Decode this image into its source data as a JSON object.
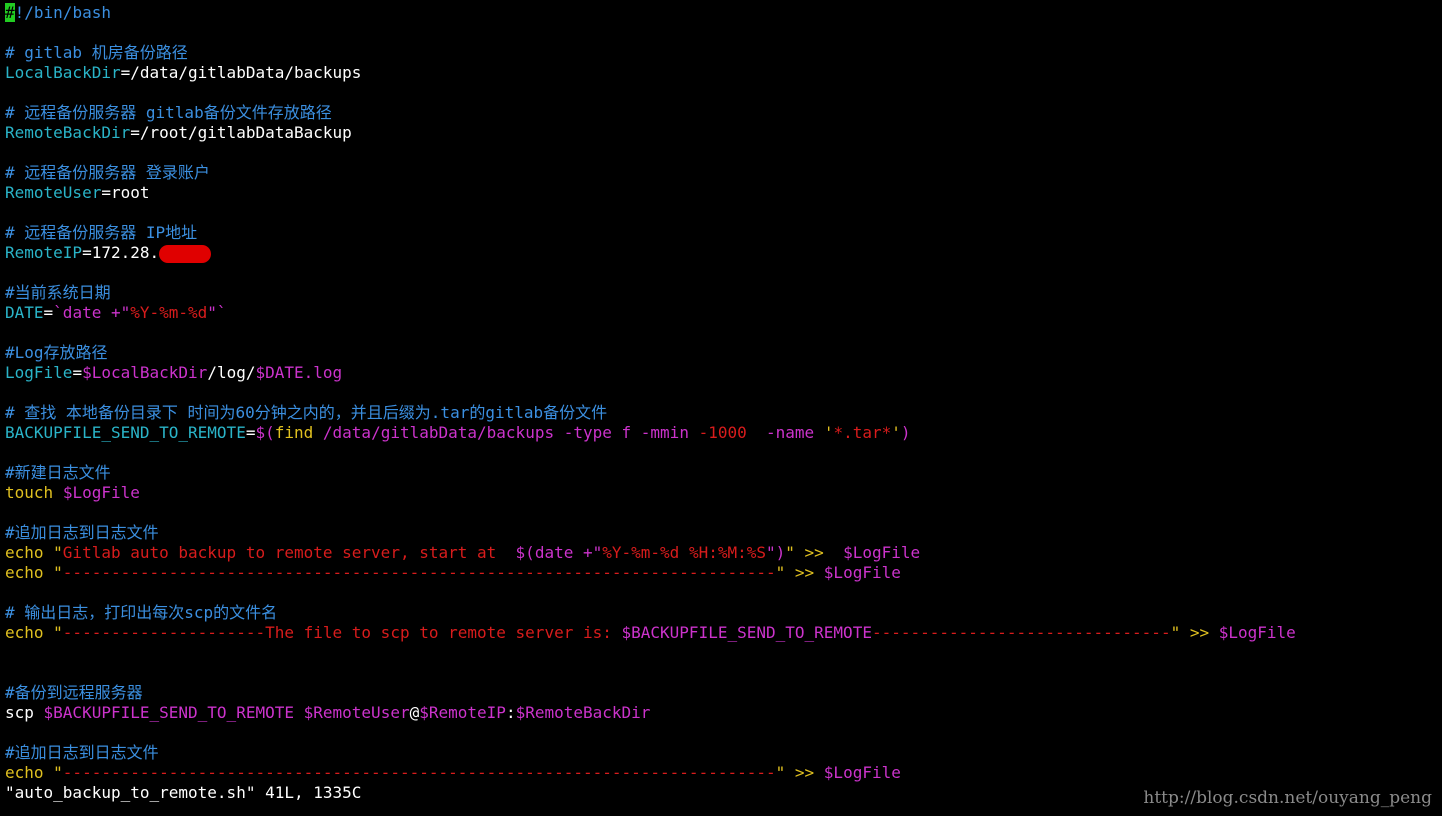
{
  "editor": {
    "status_line": "\"auto_backup_to_remote.sh\" 41L, 1335C",
    "watermark": "http://blog.csdn.net/ouyang_peng"
  },
  "colors": {
    "comment": "#3b8fe0",
    "variable": "#2ab4c8",
    "plain": "#ffffff",
    "string": "#d81c1c",
    "expansion": "#cc33cc",
    "keyword": "#e0c020",
    "cursor": "#22cc22",
    "redaction": "#e00000"
  },
  "lines": [
    {
      "segments": [
        {
          "text": "#",
          "cls": "cursor"
        },
        {
          "text": "!/bin/bash",
          "color": "#3b8fe0"
        }
      ]
    },
    {
      "segments": []
    },
    {
      "segments": [
        {
          "text": "# gitlab 机房备份路径",
          "color": "#3b8fe0"
        }
      ]
    },
    {
      "segments": [
        {
          "text": "LocalBackDir",
          "color": "#2ab4c8"
        },
        {
          "text": "=/data/gitlabData/backups",
          "color": "#ffffff"
        }
      ]
    },
    {
      "segments": []
    },
    {
      "segments": [
        {
          "text": "# 远程备份服务器 gitlab备份文件存放路径",
          "color": "#3b8fe0"
        }
      ]
    },
    {
      "segments": [
        {
          "text": "RemoteBackDir",
          "color": "#2ab4c8"
        },
        {
          "text": "=/root/gitlabDataBackup",
          "color": "#ffffff"
        }
      ]
    },
    {
      "segments": []
    },
    {
      "segments": [
        {
          "text": "# 远程备份服务器 登录账户",
          "color": "#3b8fe0"
        }
      ]
    },
    {
      "segments": [
        {
          "text": "RemoteUser",
          "color": "#2ab4c8"
        },
        {
          "text": "=root",
          "color": "#ffffff"
        }
      ]
    },
    {
      "segments": []
    },
    {
      "segments": [
        {
          "text": "# 远程备份服务器 IP地址",
          "color": "#3b8fe0"
        }
      ]
    },
    {
      "segments": [
        {
          "text": "RemoteIP",
          "color": "#2ab4c8"
        },
        {
          "text": "=172.28.",
          "color": "#ffffff"
        },
        {
          "redacted": true
        }
      ]
    },
    {
      "segments": []
    },
    {
      "segments": [
        {
          "text": "#当前系统日期",
          "color": "#3b8fe0"
        }
      ]
    },
    {
      "segments": [
        {
          "text": "DATE",
          "color": "#2ab4c8"
        },
        {
          "text": "=",
          "color": "#ffffff"
        },
        {
          "text": "`date +\"",
          "color": "#cc33cc"
        },
        {
          "text": "%Y-%m-%d",
          "color": "#d81c1c"
        },
        {
          "text": "\"`",
          "color": "#cc33cc"
        }
      ]
    },
    {
      "segments": []
    },
    {
      "segments": [
        {
          "text": "#Log存放路径",
          "color": "#3b8fe0"
        }
      ]
    },
    {
      "segments": [
        {
          "text": "LogFile",
          "color": "#2ab4c8"
        },
        {
          "text": "=",
          "color": "#ffffff"
        },
        {
          "text": "$LocalBackDir",
          "color": "#cc33cc"
        },
        {
          "text": "/log/",
          "color": "#ffffff"
        },
        {
          "text": "$DATE",
          "color": "#cc33cc"
        },
        {
          "text": ".log",
          "color": "#cc33cc"
        }
      ]
    },
    {
      "segments": []
    },
    {
      "segments": [
        {
          "text": "# 查找 本地备份目录下 时间为60分钟之内的，并且后缀为.tar的gitlab备份文件",
          "color": "#3b8fe0"
        }
      ]
    },
    {
      "segments": [
        {
          "text": "BACKUPFILE_SEND_TO_REMOTE",
          "color": "#2ab4c8"
        },
        {
          "text": "=",
          "color": "#ffffff"
        },
        {
          "text": "$(",
          "color": "#cc33cc"
        },
        {
          "text": "find",
          "color": "#e0c020"
        },
        {
          "text": " /data/gitlabData/backups -type f -mmin ",
          "color": "#cc33cc"
        },
        {
          "text": "-1000",
          "color": "#d81c1c"
        },
        {
          "text": "  -name ",
          "color": "#cc33cc"
        },
        {
          "text": "'",
          "color": "#e0c020"
        },
        {
          "text": "*.tar*",
          "color": "#d81c1c"
        },
        {
          "text": "'",
          "color": "#e0c020"
        },
        {
          "text": ")",
          "color": "#cc33cc"
        }
      ]
    },
    {
      "segments": []
    },
    {
      "segments": [
        {
          "text": "#新建日志文件",
          "color": "#3b8fe0"
        }
      ]
    },
    {
      "segments": [
        {
          "text": "touch",
          "color": "#e0c020"
        },
        {
          "text": " ",
          "color": "#ffffff"
        },
        {
          "text": "$LogFile",
          "color": "#cc33cc"
        }
      ]
    },
    {
      "segments": []
    },
    {
      "segments": [
        {
          "text": "#追加日志到日志文件",
          "color": "#3b8fe0"
        }
      ]
    },
    {
      "segments": [
        {
          "text": "echo",
          "color": "#e0c020"
        },
        {
          "text": " \"",
          "color": "#e0c020"
        },
        {
          "text": "Gitlab auto backup to remote server, start at  ",
          "color": "#d81c1c"
        },
        {
          "text": "$(date +\"",
          "color": "#cc33cc"
        },
        {
          "text": "%Y-%m-%d %H:%M:%S",
          "color": "#d81c1c"
        },
        {
          "text": "\")",
          "color": "#cc33cc"
        },
        {
          "text": "\" >>  ",
          "color": "#e0c020"
        },
        {
          "text": "$LogFile",
          "color": "#cc33cc"
        }
      ]
    },
    {
      "segments": [
        {
          "text": "echo",
          "color": "#e0c020"
        },
        {
          "text": " \"",
          "color": "#e0c020"
        },
        {
          "text": "--------------------------------------------------------------------------",
          "color": "#d81c1c"
        },
        {
          "text": "\" >> ",
          "color": "#e0c020"
        },
        {
          "text": "$LogFile",
          "color": "#cc33cc"
        }
      ]
    },
    {
      "segments": []
    },
    {
      "segments": [
        {
          "text": "# 输出日志，打印出每次scp的文件名",
          "color": "#3b8fe0"
        }
      ]
    },
    {
      "segments": [
        {
          "text": "echo",
          "color": "#e0c020"
        },
        {
          "text": " \"",
          "color": "#e0c020"
        },
        {
          "text": "---------------------The file to scp to remote server is: ",
          "color": "#d81c1c"
        },
        {
          "text": "$BACKUPFILE_SEND_TO_REMOTE",
          "color": "#cc33cc"
        },
        {
          "text": "-------------------------------",
          "color": "#d81c1c"
        },
        {
          "text": "\" >> ",
          "color": "#e0c020"
        },
        {
          "text": "$LogFile",
          "color": "#cc33cc"
        }
      ]
    },
    {
      "segments": []
    },
    {
      "segments": []
    },
    {
      "segments": [
        {
          "text": "#备份到远程服务器",
          "color": "#3b8fe0"
        }
      ]
    },
    {
      "segments": [
        {
          "text": "scp ",
          "color": "#ffffff"
        },
        {
          "text": "$BACKUPFILE_SEND_TO_REMOTE",
          "color": "#cc33cc"
        },
        {
          "text": " ",
          "color": "#ffffff"
        },
        {
          "text": "$RemoteUser",
          "color": "#cc33cc"
        },
        {
          "text": "@",
          "color": "#ffffff"
        },
        {
          "text": "$RemoteIP",
          "color": "#cc33cc"
        },
        {
          "text": ":",
          "color": "#ffffff"
        },
        {
          "text": "$RemoteBackDir",
          "color": "#cc33cc"
        }
      ]
    },
    {
      "segments": []
    },
    {
      "segments": [
        {
          "text": "#追加日志到日志文件",
          "color": "#3b8fe0"
        }
      ]
    },
    {
      "segments": [
        {
          "text": "echo",
          "color": "#e0c020"
        },
        {
          "text": " \"",
          "color": "#e0c020"
        },
        {
          "text": "--------------------------------------------------------------------------",
          "color": "#d81c1c"
        },
        {
          "text": "\" >> ",
          "color": "#e0c020"
        },
        {
          "text": "$LogFile",
          "color": "#cc33cc"
        }
      ]
    }
  ]
}
